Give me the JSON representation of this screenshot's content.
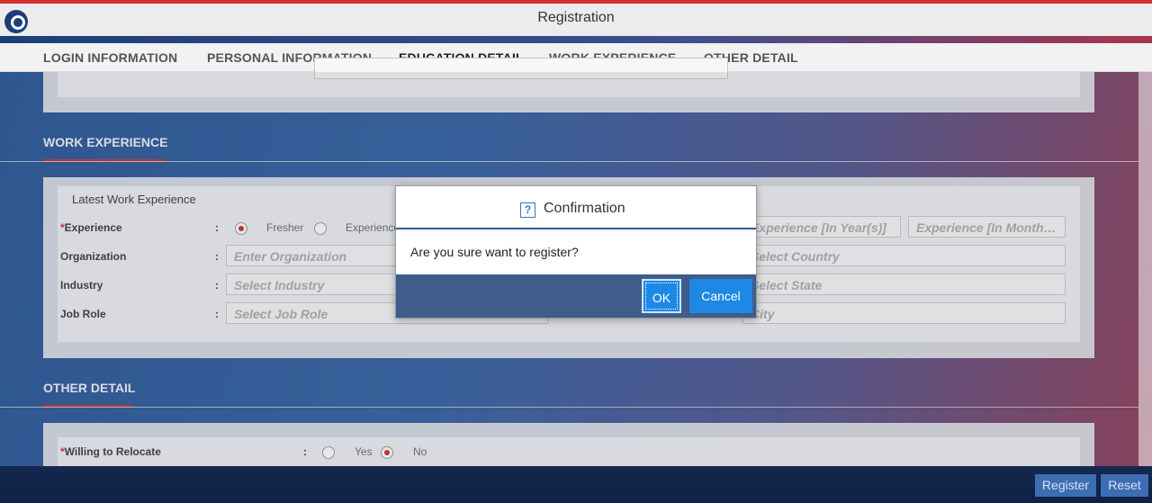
{
  "header": {
    "title": "Registration"
  },
  "tabs": [
    {
      "label": "LOGIN INFORMATION"
    },
    {
      "label": "PERSONAL INFORMATION"
    },
    {
      "label": "EDUCATION DETAIL"
    },
    {
      "label": "WORK EXPERIENCE"
    },
    {
      "label": "OTHER DETAIL"
    }
  ],
  "work": {
    "section_title": "WORK EXPERIENCE",
    "subtitle": "Latest Work Experience",
    "experience_label": "Experience",
    "fresher_label": "Fresher",
    "experienced_label": "Experience",
    "exp_years_placeholder": "Experience [In Year(s)]",
    "exp_months_placeholder": "Experience [In Month…",
    "organization_label": "Organization",
    "organization_placeholder": "Enter Organization",
    "country_placeholder": "Select Country",
    "industry_label": "Industry",
    "industry_placeholder": "Select Industry",
    "state_placeholder": "Select State",
    "jobrole_label": "Job Role",
    "jobrole_placeholder": "Select Job Role",
    "city_placeholder": "City",
    "colon": ":"
  },
  "other": {
    "section_title": "OTHER DETAIL",
    "relocate_label": "Willing to Relocate",
    "yes_label": "Yes",
    "no_label": "No"
  },
  "dialog": {
    "title": "Confirmation",
    "icon": "?",
    "message": "Are you sure want to register?",
    "ok_label": "OK",
    "cancel_label": "Cancel"
  },
  "footer": {
    "register_label": "Register",
    "reset_label": "Reset"
  }
}
